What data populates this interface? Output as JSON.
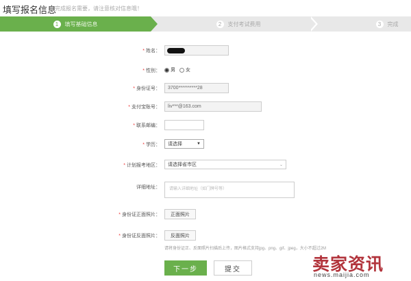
{
  "header": {
    "title": "填写报名信息",
    "subtitle": "完成报名需要，请注意核对信息哦！"
  },
  "steps": [
    {
      "num": "1",
      "label": "填写基础信息",
      "active": true
    },
    {
      "num": "2",
      "label": "支付考试费用",
      "active": false
    },
    {
      "num": "3",
      "label": "完成",
      "active": false
    }
  ],
  "form": {
    "name": {
      "label": "姓名："
    },
    "gender": {
      "label": "性别：",
      "options": [
        "男",
        "女"
      ],
      "selected": "男"
    },
    "id_number": {
      "label": "身份证号：",
      "value": "3700**********28"
    },
    "alipay": {
      "label": "支付宝账号：",
      "value": "liv***@163.com"
    },
    "zipcode": {
      "label": "联系邮编：",
      "value": ""
    },
    "education": {
      "label": "学历：",
      "value": "请选择"
    },
    "region": {
      "label": "计划报考地区：",
      "value": "请选择省市区"
    },
    "address": {
      "label": "详细地址：",
      "placeholder": "请输入详细地址（如门牌号等）"
    },
    "id_front": {
      "label": "身份证正面照片：",
      "button": "正面照片"
    },
    "id_back": {
      "label": "身份证反面照片：",
      "button": "反面照片"
    }
  },
  "hint": "请将身份证正、反面照片扫描后上传，图片格式支持jpg、png、gif、jpeg，大小不超过2M",
  "buttons": {
    "next": "下一步",
    "submit": "提交"
  },
  "watermark": {
    "text": "卖家资讯",
    "url": "news.maijia.com",
    "color": "#b2343c"
  },
  "colors": {
    "accent": "#6ab04c",
    "required": "#ee3333"
  }
}
